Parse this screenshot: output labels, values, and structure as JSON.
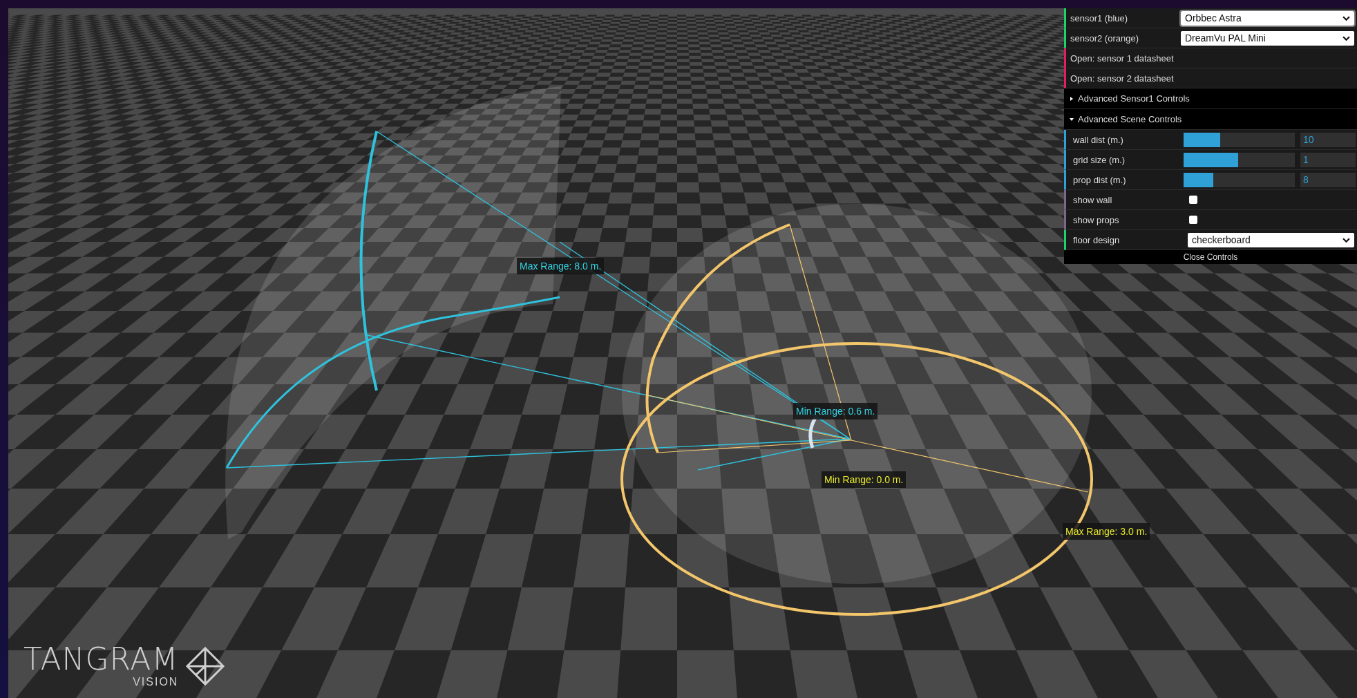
{
  "scene": {
    "labels": [
      {
        "text": "Max Range: 8.0 m.",
        "kind": "sensor1"
      },
      {
        "text": "Min Range: 0.6 m.",
        "kind": "sensor1"
      },
      {
        "text": "Min Range: 0.0 m.",
        "kind": "sensor2"
      },
      {
        "text": "Max Range: 3.0 m.",
        "kind": "sensor2"
      }
    ]
  },
  "controls": {
    "sensors": [
      {
        "label": "sensor1 (blue)",
        "value": "Orbbec Astra",
        "focused": true
      },
      {
        "label": "sensor2 (orange)",
        "value": "DreamVu PAL Mini",
        "focused": false
      }
    ],
    "links": [
      "Open: sensor 1 datasheet",
      "Open: sensor 2 datasheet"
    ],
    "folders": [
      {
        "title": "Advanced Sensor1 Controls",
        "expanded": false
      },
      {
        "title": "Advanced Scene Controls",
        "expanded": true,
        "items": [
          {
            "kind": "slider",
            "label": "wall dist (m.)",
            "level": 0.33,
            "value": "10"
          },
          {
            "kind": "slider",
            "label": "grid size (m.)",
            "level": 0.49,
            "value": "1"
          },
          {
            "kind": "slider",
            "label": "prop dist (m.)",
            "level": 0.27,
            "value": "8"
          },
          {
            "kind": "checkbox",
            "label": "show wall",
            "checked": false
          },
          {
            "kind": "checkbox",
            "label": "show props",
            "checked": false
          },
          {
            "kind": "select",
            "label": "floor design",
            "value": "checkerboard"
          }
        ]
      }
    ],
    "close_button": "Close Controls"
  },
  "logo": {
    "name": "TANGRAM",
    "subtitle": "VISION"
  }
}
